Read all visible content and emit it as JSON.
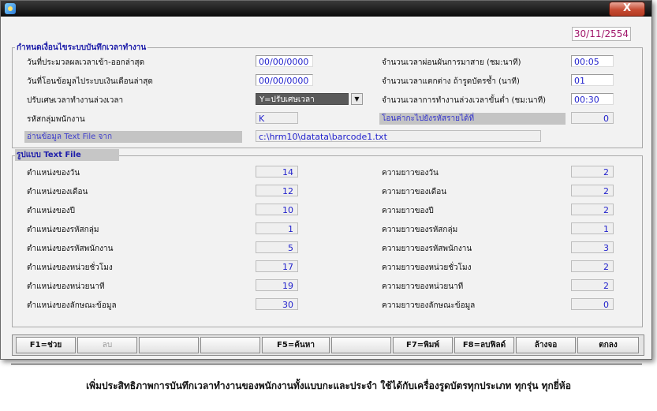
{
  "window": {
    "close_label": "X"
  },
  "date": "30/11/2554",
  "section1": {
    "title": "กำหนดเงื่อนไขระบบบันทึกเวลาทำงาน",
    "last_scan_label": "วันที่ประมวลผลเวลาเข้า-ออกล่าสุด",
    "last_scan_value": "00/00/0000",
    "last_transfer_label": "วันที่โอนข้อมูลไประบบเงินเดือนล่าสุด",
    "last_transfer_value": "00/00/0000",
    "adjust_label": "ปรับเศษเวลาทำงานล่วงเวลา",
    "adjust_value": "Y=ปรับเศษเวลา",
    "group_code_label": "รหัสกลุ่มพนักงาน",
    "group_code_value": "K",
    "read_file_label": "อ่านข้อมูล Text File จาก",
    "read_file_value": "c:\\hrm10\\datata\\barcode1.txt",
    "late_grace_label": "จำนวนเวลาผ่อนผันการมาสาย (ชม:นาที)",
    "late_grace_value": "00:05",
    "dup_scan_label": "จำนวนเวลาแตกต่าง ถ้ารูดบัตรซ้ำ (นาที)",
    "dup_scan_value": "01",
    "min_ot_label": "จำนวนเวลาการทำงานล่วงเวลาขั้นต่ำ (ชม:นาที)",
    "min_ot_value": "00:30",
    "transfer_code_label": "โอนค่ากะไปยังรหัสรายได้ที่",
    "transfer_code_value": "0"
  },
  "section2": {
    "title": "รูปแบบ Text File",
    "left": [
      {
        "label": "ตำแหน่งของวัน",
        "value": "14"
      },
      {
        "label": "ตำแหน่งของเดือน",
        "value": "12"
      },
      {
        "label": "ตำแหน่งของปี",
        "value": "10"
      },
      {
        "label": "ตำแหน่งของรหัสกลุ่ม",
        "value": "1"
      },
      {
        "label": "ตำแหน่งของรหัสพนักงาน",
        "value": "5"
      },
      {
        "label": "ตำแหน่งของหน่วยชั่วโมง",
        "value": "17"
      },
      {
        "label": "ตำแหน่งของหน่วยนาที",
        "value": "19"
      },
      {
        "label": "ตำแหน่งของลักษณะข้อมูล",
        "value": "30"
      }
    ],
    "right": [
      {
        "label": "ความยาวของวัน",
        "value": "2"
      },
      {
        "label": "ความยาวของเดือน",
        "value": "2"
      },
      {
        "label": "ความยาวของปี",
        "value": "2"
      },
      {
        "label": "ความยาวของรหัสกลุ่ม",
        "value": "1"
      },
      {
        "label": "ความยาวของรหัสพนักงาน",
        "value": "3"
      },
      {
        "label": "ความยาวของหน่วยชั่วโมง",
        "value": "2"
      },
      {
        "label": "ความยาวของหน่วยนาที",
        "value": "2"
      },
      {
        "label": "ความยาวของลักษณะข้อมูล",
        "value": "0"
      }
    ]
  },
  "toolbar": {
    "f1": "F1=ช่วย",
    "delete": "ลบ",
    "f5": "F5=ค้นหา",
    "f7": "F7=พิมพ์",
    "f8": "F8=ลบฟิลด์",
    "clear": "ล้างจอ",
    "ok": "ตกลง"
  },
  "footer": "เพิ่มประสิทธิภาพการบันทึกเวลาทำงานของพนักงานทั้งแบบกะและประจำ ใช้ได้กับเครื่องรูดบัตรทุกประเภท ทุกรุ่น ทุกยี่ห้อ"
}
